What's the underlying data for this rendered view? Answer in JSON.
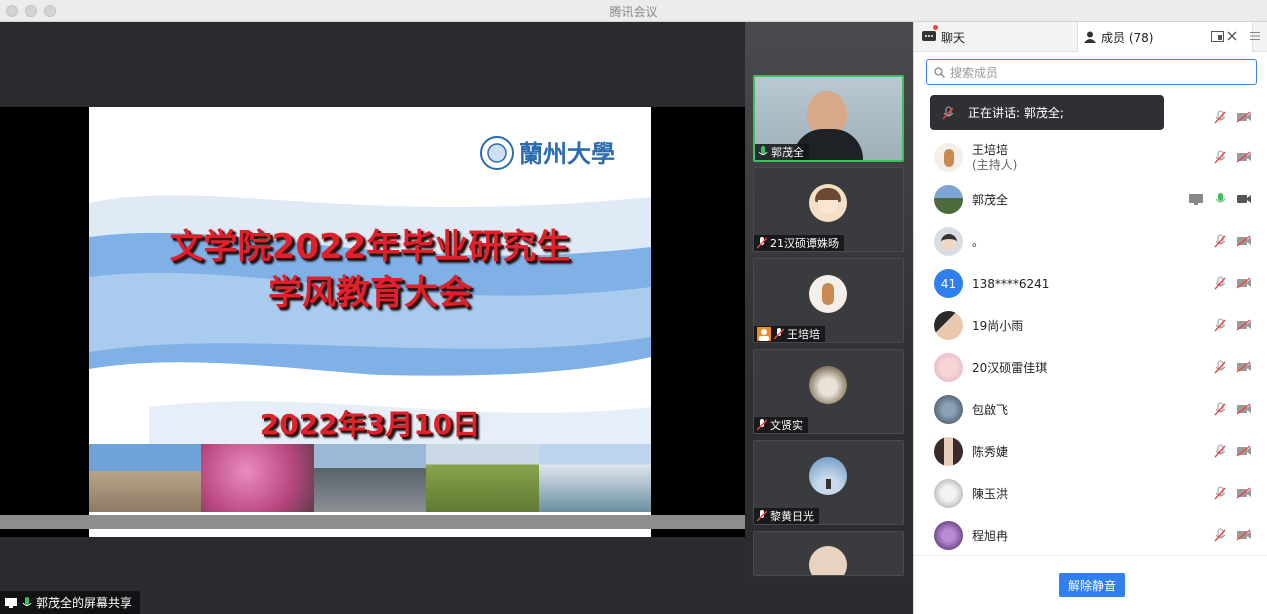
{
  "window": {
    "title": "腾讯会议"
  },
  "slide": {
    "logo_text": "蘭州大學",
    "title_line1": "文学院2022年毕业研究生",
    "title_line2": "学风教育大会",
    "date": "2022年3月10日"
  },
  "share_label": "郭茂全的屏幕共享",
  "video_tiles": [
    {
      "name": "郭茂全",
      "mic": "on",
      "active": true
    },
    {
      "name": "21汉硕谭姝旸",
      "mic": "muted"
    },
    {
      "name": "王培培",
      "mic": "muted",
      "host": true
    },
    {
      "name": "文贤实",
      "mic": "muted"
    },
    {
      "name": "黎黄日光",
      "mic": "muted"
    }
  ],
  "panel": {
    "tab_chat": "聊天",
    "tab_members": "成员 (78)",
    "search_placeholder": "搜索成员",
    "speaking": "正在讲话: 郭茂全;",
    "members": [
      {
        "name": "",
        "sub": ""
      },
      {
        "name": "王培培",
        "sub": "(主持人)"
      },
      {
        "name": "郭茂全",
        "sub": "",
        "sharing": true,
        "mic": "on",
        "cam": "on"
      },
      {
        "name": "。",
        "sub": ""
      },
      {
        "name": "138****6241",
        "sub": "",
        "badge": "41"
      },
      {
        "name": "19尚小雨",
        "sub": ""
      },
      {
        "name": "20汉硕雷佳琪",
        "sub": ""
      },
      {
        "name": "包啟飞",
        "sub": ""
      },
      {
        "name": "陈秀婕",
        "sub": ""
      },
      {
        "name": "陳玉洪",
        "sub": ""
      },
      {
        "name": "程旭冉",
        "sub": ""
      }
    ],
    "unmute_label": "解除静音"
  },
  "colors": {
    "accent": "#2f7ff0",
    "active_border": "#3ebf5b",
    "slide_title": "#e0212b"
  }
}
